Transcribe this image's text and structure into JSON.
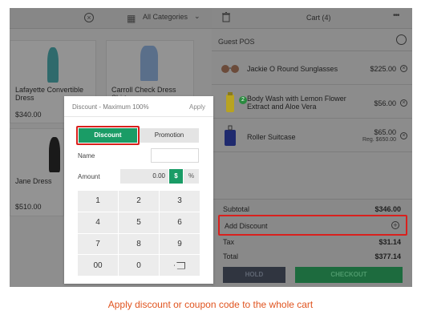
{
  "left_panel": {
    "category_label": "All Categories",
    "products": [
      {
        "name": "Lafayette Convertible Dress",
        "price": "$340.00"
      },
      {
        "name": "Carroll Check Dress Shirt",
        "price": ""
      },
      {
        "name": "Jane Dress",
        "price": "$510.00"
      }
    ]
  },
  "cart": {
    "title": "Cart (4)",
    "customer": "Guest POS",
    "items": [
      {
        "name": "Jackie O Round Sunglasses",
        "price": "$225.00",
        "reg": ""
      },
      {
        "name": "Body Wash with Lemon Flower Extract and Aloe Vera",
        "price": "$56.00",
        "reg": "",
        "qty_badge": "2"
      },
      {
        "name": "Roller Suitcase",
        "price": "$65.00",
        "reg": "Reg. $650.00"
      }
    ],
    "summary": {
      "subtotal_label": "Subtotal",
      "subtotal": "$346.00",
      "add_discount_label": "Add Discount",
      "tax_label": "Tax",
      "tax": "$31.14",
      "total_label": "Total",
      "total": "$377.14"
    },
    "hold_label": "HOLD",
    "checkout_label": "CHECKOUT"
  },
  "discount_modal": {
    "title": "Discount - Maximum 100%",
    "apply_label": "Apply",
    "tab_discount": "Discount",
    "tab_promotion": "Promotion",
    "name_label": "Name",
    "amount_label": "Amount",
    "amount_value": "0.00",
    "dollar_label": "$",
    "percent_label": "%",
    "keys": [
      "1",
      "2",
      "3",
      "4",
      "5",
      "6",
      "7",
      "8",
      "9",
      "00",
      "0"
    ]
  },
  "caption": "Apply discount or coupon code to the whole cart",
  "colors": {
    "accent_green": "#1a9c66",
    "highlight_red": "#d9201d",
    "caption_orange": "#e0541f"
  }
}
